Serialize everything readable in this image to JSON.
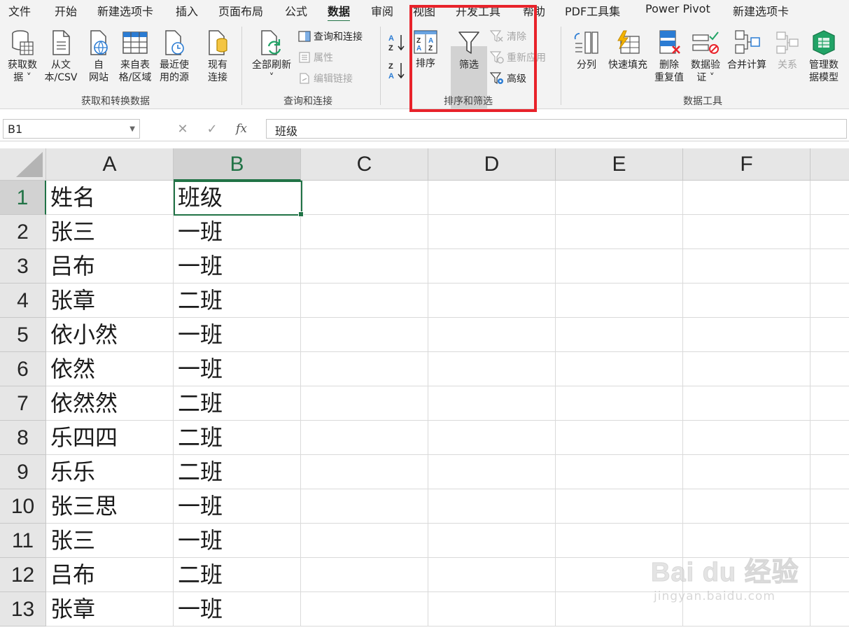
{
  "menu": {
    "tabs": [
      {
        "label": "文件"
      },
      {
        "label": "开始"
      },
      {
        "label": "新建选项卡"
      },
      {
        "label": "插入"
      },
      {
        "label": "页面布局"
      },
      {
        "label": "公式"
      },
      {
        "label": "数据",
        "active": true
      },
      {
        "label": "审阅"
      },
      {
        "label": "视图"
      },
      {
        "label": "开发工具"
      },
      {
        "label": "帮助"
      },
      {
        "label": "PDF工具集"
      },
      {
        "label": "Power Pivot"
      },
      {
        "label": "新建选项卡"
      }
    ]
  },
  "ribbon": {
    "get_transform": {
      "group_label": "获取和转换数据",
      "get_data": {
        "line1": "获取数",
        "line2": "据 ˅"
      },
      "from_csv": {
        "line1": "从文",
        "line2": "本/CSV"
      },
      "from_web": {
        "line1": "自",
        "line2": "网站"
      },
      "from_table": {
        "line1": "来自表",
        "line2": "格/区域"
      },
      "recent_sources": {
        "line1": "最近使",
        "line2": "用的源"
      },
      "existing_connections": {
        "line1": "现有",
        "line2": "连接"
      }
    },
    "queries": {
      "group_label": "查询和连接",
      "refresh_all": {
        "line1": "全部刷新",
        "line2": "˅"
      },
      "queries_connections": "查询和连接",
      "properties": "属性",
      "edit_links": "编辑链接"
    },
    "sort_filter": {
      "group_label": "排序和筛选",
      "sort": "排序",
      "filter": "筛选",
      "clear": "清除",
      "reapply": "重新应用",
      "advanced": "高级"
    },
    "data_tools": {
      "group_label": "数据工具",
      "text_to_columns": "分列",
      "flash_fill": "快速填充",
      "remove_duplicates": {
        "line1": "删除",
        "line2": "重复值"
      },
      "data_validation": {
        "line1": "数据验",
        "line2": "证 ˅"
      },
      "consolidate": "合并计算",
      "relationships": "关系",
      "manage_model": {
        "line1": "管理数",
        "line2": "据模型"
      }
    }
  },
  "formula_bar": {
    "name_box": "B1",
    "cancel_symbol": "✕",
    "enter_symbol": "✓",
    "fx_symbol": "fx",
    "content": "班级"
  },
  "sheet": {
    "columns": [
      "A",
      "B",
      "C",
      "D",
      "E",
      "F"
    ],
    "selected_column": "B",
    "selected_row": 1,
    "rows": [
      {
        "num": "1",
        "a": "姓名",
        "b": "班级"
      },
      {
        "num": "2",
        "a": "张三",
        "b": "一班"
      },
      {
        "num": "3",
        "a": "吕布",
        "b": "一班"
      },
      {
        "num": "4",
        "a": "张章",
        "b": "二班"
      },
      {
        "num": "5",
        "a": "依小然",
        "b": "一班"
      },
      {
        "num": "6",
        "a": "依然",
        "b": "一班"
      },
      {
        "num": "7",
        "a": "依然然",
        "b": "二班"
      },
      {
        "num": "8",
        "a": "乐四四",
        "b": "二班"
      },
      {
        "num": "9",
        "a": "乐乐",
        "b": "二班"
      },
      {
        "num": "10",
        "a": "张三思",
        "b": "一班"
      },
      {
        "num": "11",
        "a": "张三",
        "b": "一班"
      },
      {
        "num": "12",
        "a": "吕布",
        "b": "二班"
      },
      {
        "num": "13",
        "a": "张章",
        "b": "一班"
      }
    ]
  },
  "watermark": {
    "main": "Bai du 经验",
    "sub": "jingyan.baidu.com"
  },
  "colors": {
    "excel_green": "#217346",
    "highlight_red": "#e8222a",
    "ribbon_bg": "#f3f3f3",
    "header_bg": "#e6e6e6"
  }
}
